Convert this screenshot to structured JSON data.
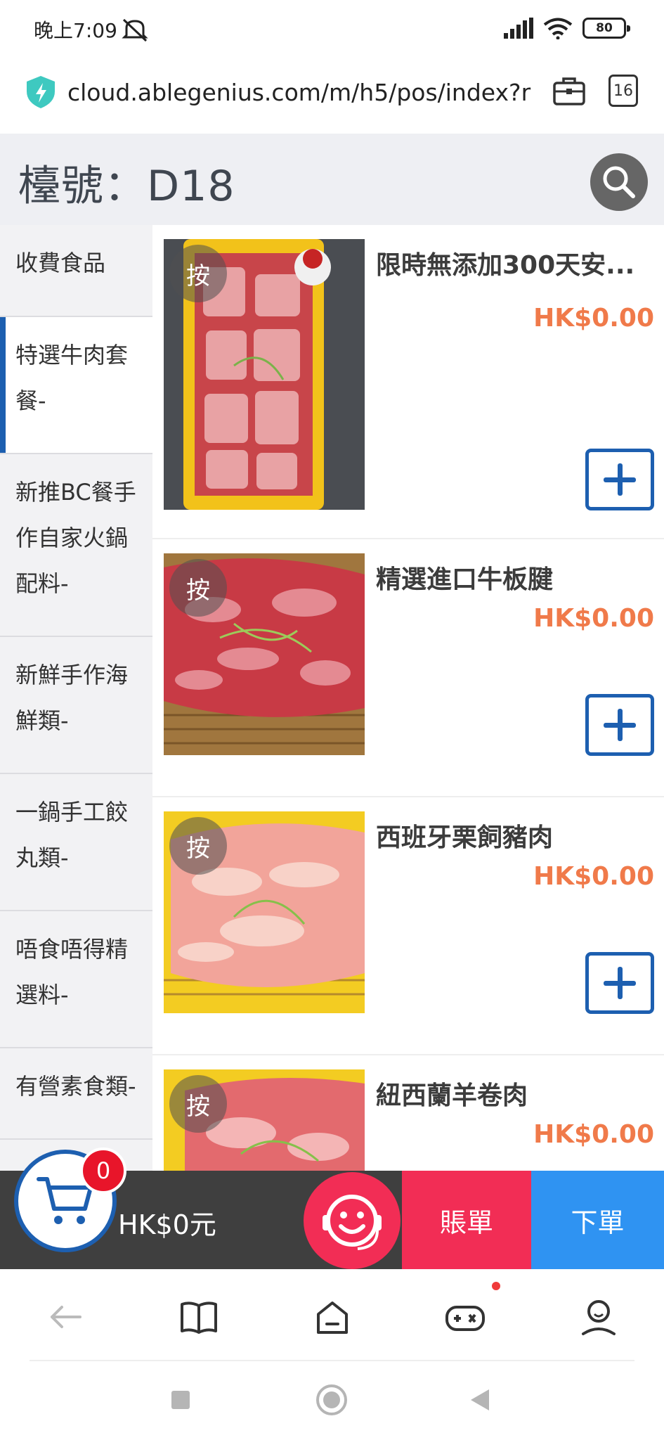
{
  "status_bar": {
    "time": "晚上7:09",
    "battery": "80"
  },
  "url_bar": {
    "url": "cloud.ablegenius.com/m/h5/pos/index?ran",
    "tab_count": "16"
  },
  "header": {
    "title": "檯號：D18"
  },
  "categories": [
    {
      "label": "收費食品"
    },
    {
      "label": "特選牛肉套餐-"
    },
    {
      "label": "新推BC餐手作自家火鍋配料-"
    },
    {
      "label": "新鮮手作海鮮類-"
    },
    {
      "label": "一鍋手工餃丸類-"
    },
    {
      "label": "唔食唔得精選料-"
    },
    {
      "label": "有營素食類-"
    }
  ],
  "products": [
    {
      "name": "限時無添加300天安...",
      "price": "HK$0.00",
      "badge": "按"
    },
    {
      "name": "精選進口牛板腱",
      "price": "HK$0.00",
      "badge": "按"
    },
    {
      "name": "西班牙栗飼豬肉",
      "price": "HK$0.00",
      "badge": "按"
    },
    {
      "name": "紐西蘭羊卷肉",
      "price": "HK$0.00",
      "badge": "按"
    }
  ],
  "cart": {
    "count": "0",
    "total": "HK$0元",
    "bill_label": "賬單",
    "order_label": "下單"
  },
  "colors": {
    "accent_blue": "#1d5fb0",
    "price_orange": "#f07a4a",
    "bill_red": "#f22d55",
    "order_blue": "#2f93f2"
  }
}
